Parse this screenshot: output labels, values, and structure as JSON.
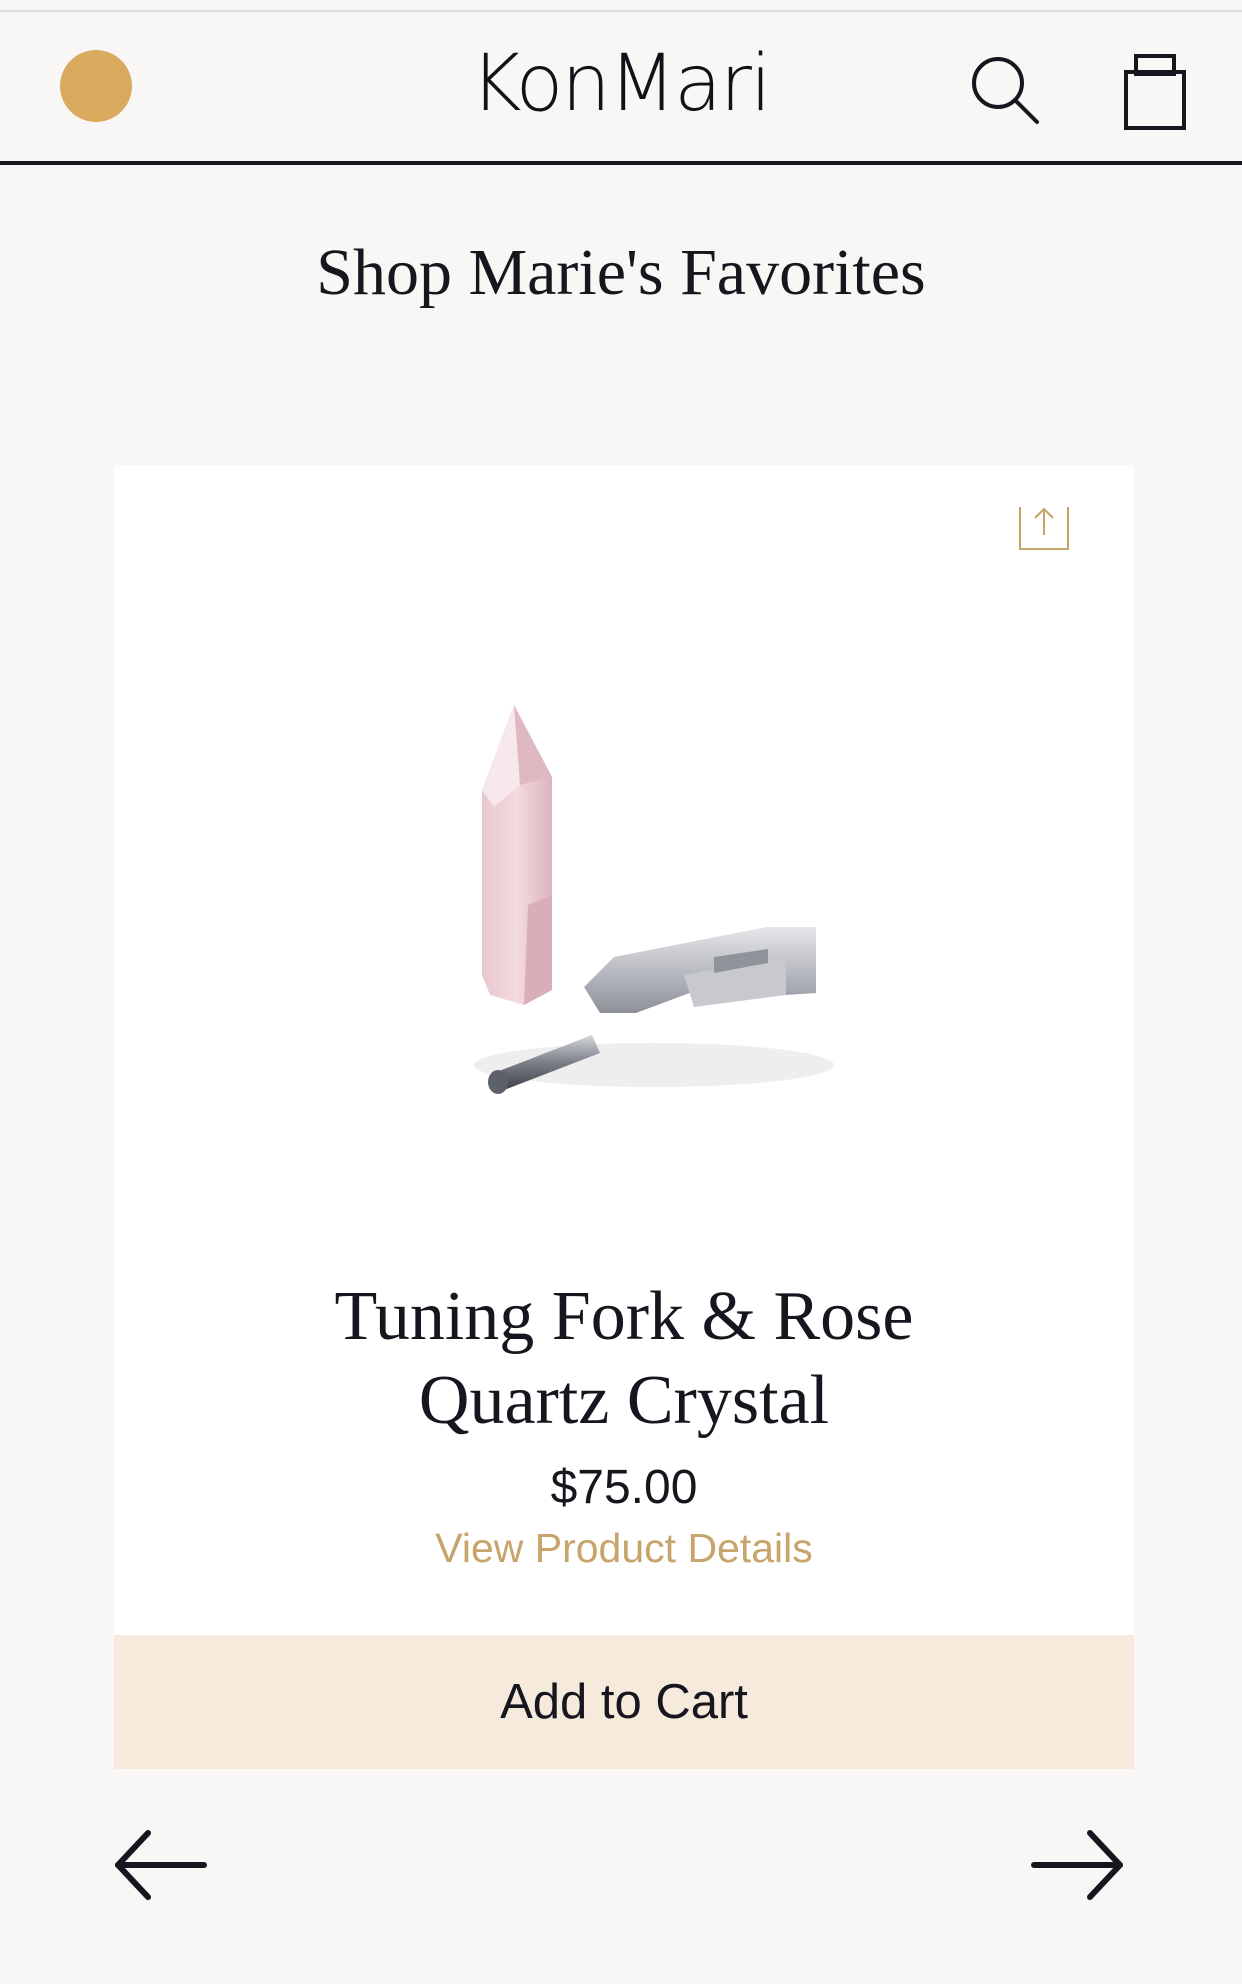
{
  "header": {
    "logo": "KonMari",
    "menu_dot_color": "#d8a95f",
    "icons": [
      "menu-dot-icon",
      "search-icon",
      "shopping-bag-icon"
    ]
  },
  "section": {
    "title": "Shop Marie's Favorites"
  },
  "product": {
    "name_line1": "Tuning Fork & Rose",
    "name_line2": "Quartz Crystal",
    "price": "$75.00",
    "details_link": "View Product Details",
    "add_to_cart": "Add to Cart",
    "share_icon": "share-icon"
  },
  "carousel": {
    "prev_icon": "arrow-left-icon",
    "next_icon": "arrow-right-icon"
  },
  "colors": {
    "accent_gold": "#c7a46a",
    "cart_button_bg": "#f5eadc",
    "text_dark": "#16161e",
    "page_bg": "#f8f7f5"
  }
}
